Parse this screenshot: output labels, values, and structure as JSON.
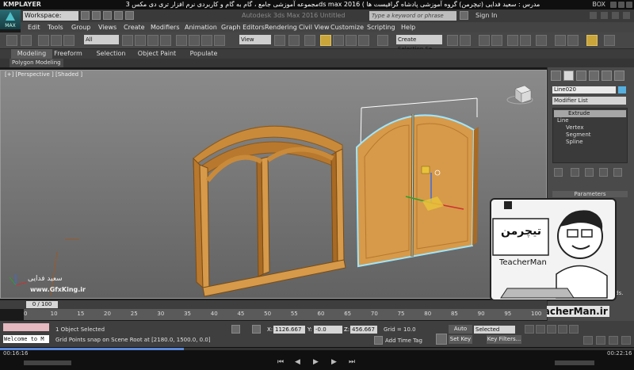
{
  "player": {
    "name": "KMPLAYER",
    "title": "مجموعه آموزشی جامع ، گام به گام و کاربردی نرم افزار تری دی مکس 3ds max 2016 ( مدرس : سعید فدایی (تیچرمن) گروه آموزشی پادشاه گرافیست ها",
    "right_label": "BOX",
    "time_elapsed": "00:16:16",
    "time_total": "00:22:16",
    "progress": 0.29
  },
  "app": {
    "logo_label": "MAX",
    "workspace": "Workspace: Default",
    "title": "Autodesk 3ds Max 2016    Untitled",
    "search_placeholder": "Type a keyword or phrase",
    "sign_in": "Sign In"
  },
  "menu": [
    "Edit",
    "Tools",
    "Group",
    "Views",
    "Create",
    "Modifiers",
    "Animation",
    "Graph Editors",
    "Rendering",
    "Civil View",
    "Customize",
    "Scripting",
    "Help"
  ],
  "toolbar": {
    "filter": "All",
    "view": "View",
    "selection_set": "Create Selection Se"
  },
  "ribbon": {
    "tabs": [
      "Modeling",
      "Freeform",
      "Selection",
      "Object Paint",
      "Populate"
    ],
    "active": "Modeling",
    "sub_label": "Polygon Modeling"
  },
  "viewport": {
    "label": "[+] [Perspective ] [Shaded ]"
  },
  "command_panel": {
    "object_name": "Line020",
    "modifier_list": "Modifier List",
    "stack": [
      "Extrude",
      "Line",
      "Vertex",
      "Segment",
      "Spline"
    ],
    "rollout": "Parameters",
    "coords_label": "Coords."
  },
  "timeline": {
    "slider": "0 / 100",
    "ticks": [
      "0",
      "10",
      "15",
      "20",
      "25",
      "30",
      "35",
      "40",
      "45",
      "50",
      "55",
      "60",
      "65",
      "70",
      "75",
      "80",
      "85",
      "90",
      "95",
      "100"
    ]
  },
  "status": {
    "welcome": "Welcome to M",
    "selected": "1 Object Selected",
    "prompt": "Grid Points snap on Scene Root at [2180.0, 1500.0, 0.0]",
    "x_label": "X:",
    "x": "1126.667",
    "y_label": "Y:",
    "y": "-0.0",
    "z_label": "Z:",
    "z": "456.667",
    "grid": "Grid = 10.0",
    "add_time_tag": "Add Time Tag",
    "auto_key": "Auto Key",
    "set_key": "Set Key",
    "selected_dropdown": "Selected",
    "key_filters": "Key Filters..."
  },
  "watermark": {
    "site": "www.TeacherMan.ir",
    "card_title": "TeacherMan",
    "card_fa": "تیچرمن",
    "left_name": "سعید فدایی",
    "left_site": "www.GfxKing.ir"
  },
  "colors": {
    "frame": "#c98a3a",
    "frame_dark": "#8a5a1e",
    "door": "#d69a4a",
    "selection": "#9fe6ff",
    "viewport_top": "#8a8a8a"
  }
}
